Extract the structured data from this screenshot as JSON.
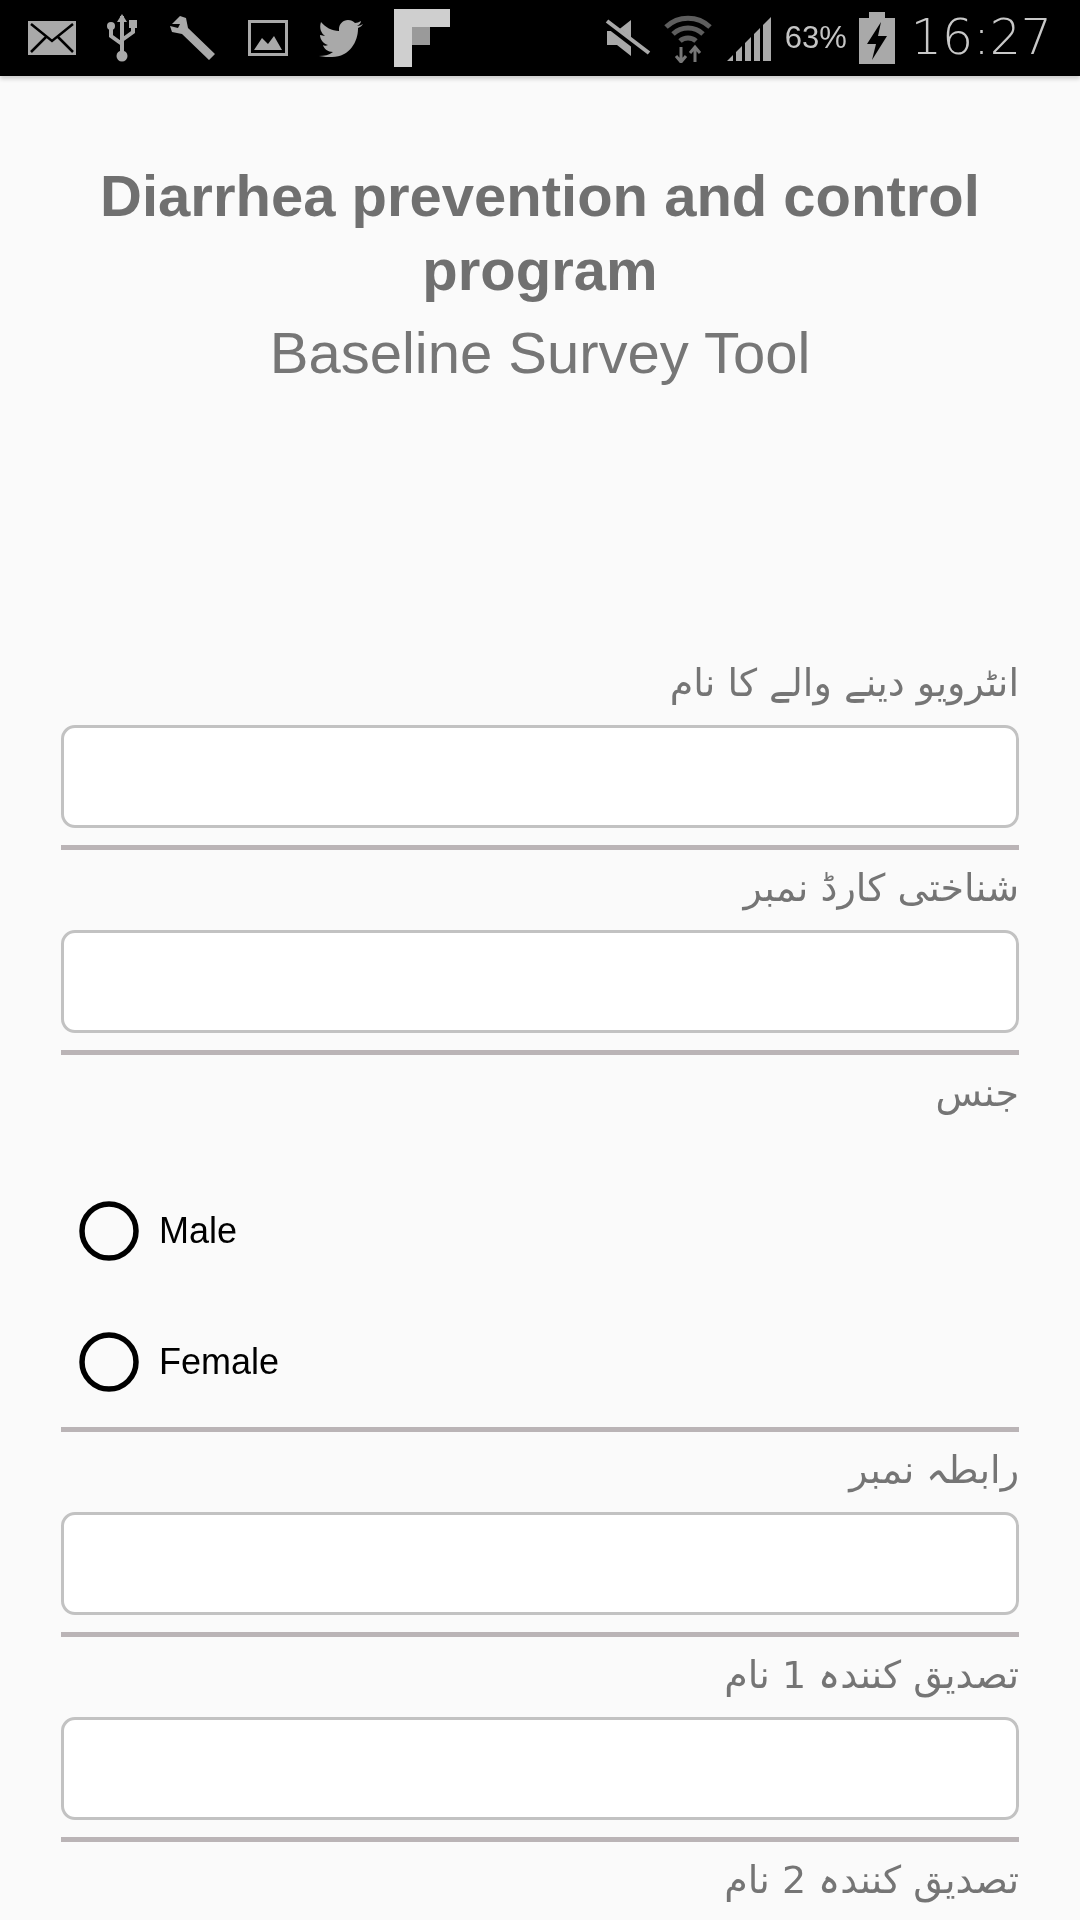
{
  "status_bar": {
    "battery": "63%",
    "time": "16:27"
  },
  "header": {
    "title": "Diarrhea prevention and control program",
    "subtitle": "Baseline Survey Tool"
  },
  "form": {
    "fields": [
      {
        "kind": "text",
        "label": "انٹرویو دینے والے کا نام"
      },
      {
        "kind": "text",
        "label": "شناختی کارڈ نمبر"
      },
      {
        "kind": "radio",
        "label": "جنس",
        "options": [
          {
            "label": "Male",
            "selected": false
          },
          {
            "label": "Female",
            "selected": false
          }
        ]
      },
      {
        "kind": "text",
        "label": "رابطہ نمبر"
      },
      {
        "kind": "text",
        "label": "تصدیق کنندہ 1 نام"
      },
      {
        "kind": "label_only",
        "label": "تصدیق کنندہ 2 نام"
      }
    ]
  }
}
